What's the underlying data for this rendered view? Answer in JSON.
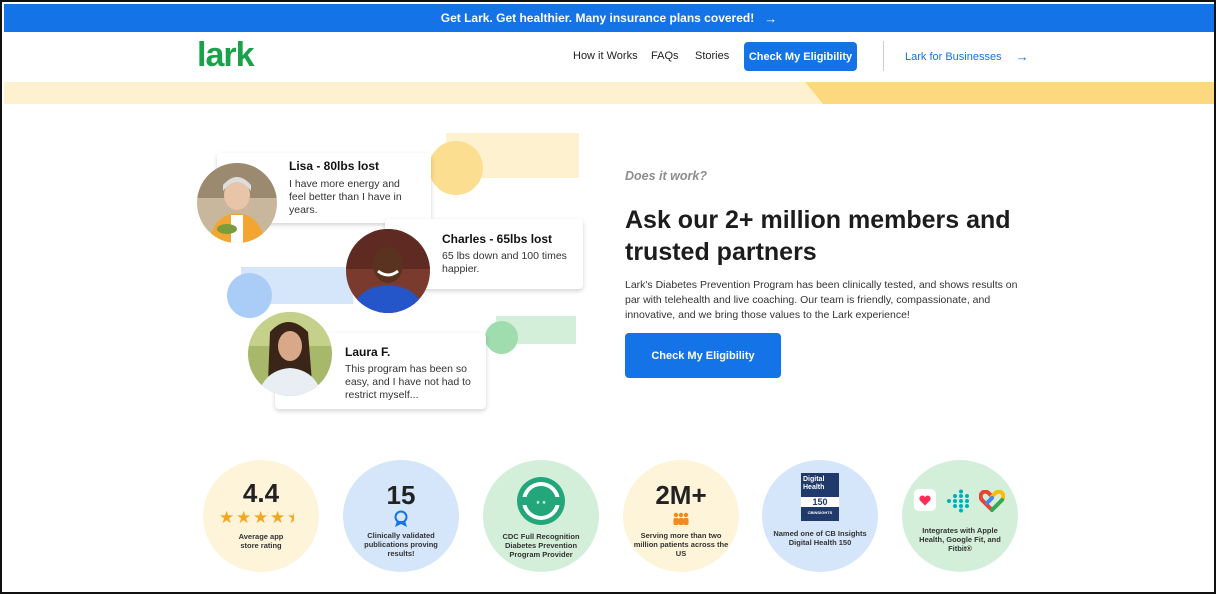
{
  "banner": {
    "text": "Get Lark. Get healthier. Many insurance plans covered!",
    "arrow": "→"
  },
  "header": {
    "logo": "lark",
    "nav": [
      "How it Works",
      "FAQs",
      "Stories"
    ],
    "cta": "Check My Eligibility",
    "business_link": "Lark for Businesses",
    "business_arrow": "→"
  },
  "testimonials": [
    {
      "name": "Lisa - 80lbs lost",
      "quote": "I have more energy and feel better than I have in years."
    },
    {
      "name": "Charles - 65lbs lost",
      "quote": "65 lbs down and 100 times happier."
    },
    {
      "name": "Laura F.",
      "quote": "This program has been so easy, and I have not had to restrict myself..."
    }
  ],
  "main": {
    "eyebrow": "Does it work?",
    "headline": "Ask our 2+ million members and trusted partners",
    "body": "Lark's Diabetes Prevention Program has been clinically tested, and shows results on par with telehealth and live coaching. Our team is friendly, compassionate, and innovative, and we bring those values to the Lark experience!",
    "cta": "Check My Eligibility"
  },
  "stats": [
    {
      "big": "4.4",
      "stars": "★★★★★",
      "rating": 4.4,
      "caption": "Average app store rating"
    },
    {
      "big": "15",
      "icon": "award-ribbon-icon",
      "caption": "Clinically validated publications proving results!"
    },
    {
      "icon": "cdc-recognition-seal-icon",
      "caption": "CDC Full Recognition Diabetes Prevention Program Provider"
    },
    {
      "big": "2M+",
      "icon": "people-group-icon",
      "caption": "Serving more than two million patients across the US"
    },
    {
      "badge_title": "Digital Health",
      "badge_number": "150",
      "badge_sub": "CBINSIGHTS",
      "caption": "Named one of CB Insights Digital Health 150"
    },
    {
      "icons": [
        "apple-health-icon",
        "fitbit-icon",
        "google-fit-icon"
      ],
      "caption": "Integrates with Apple Health, Google Fit, and Fitbit®"
    }
  ],
  "colors": {
    "primary": "#1473e6",
    "brand_green": "#1aa24a",
    "yellow_light": "#fdf1cf",
    "yellow": "#fcd97e",
    "blue_light": "#d5e6fb",
    "green_light": "#d4efd9",
    "star": "#f5a623"
  }
}
